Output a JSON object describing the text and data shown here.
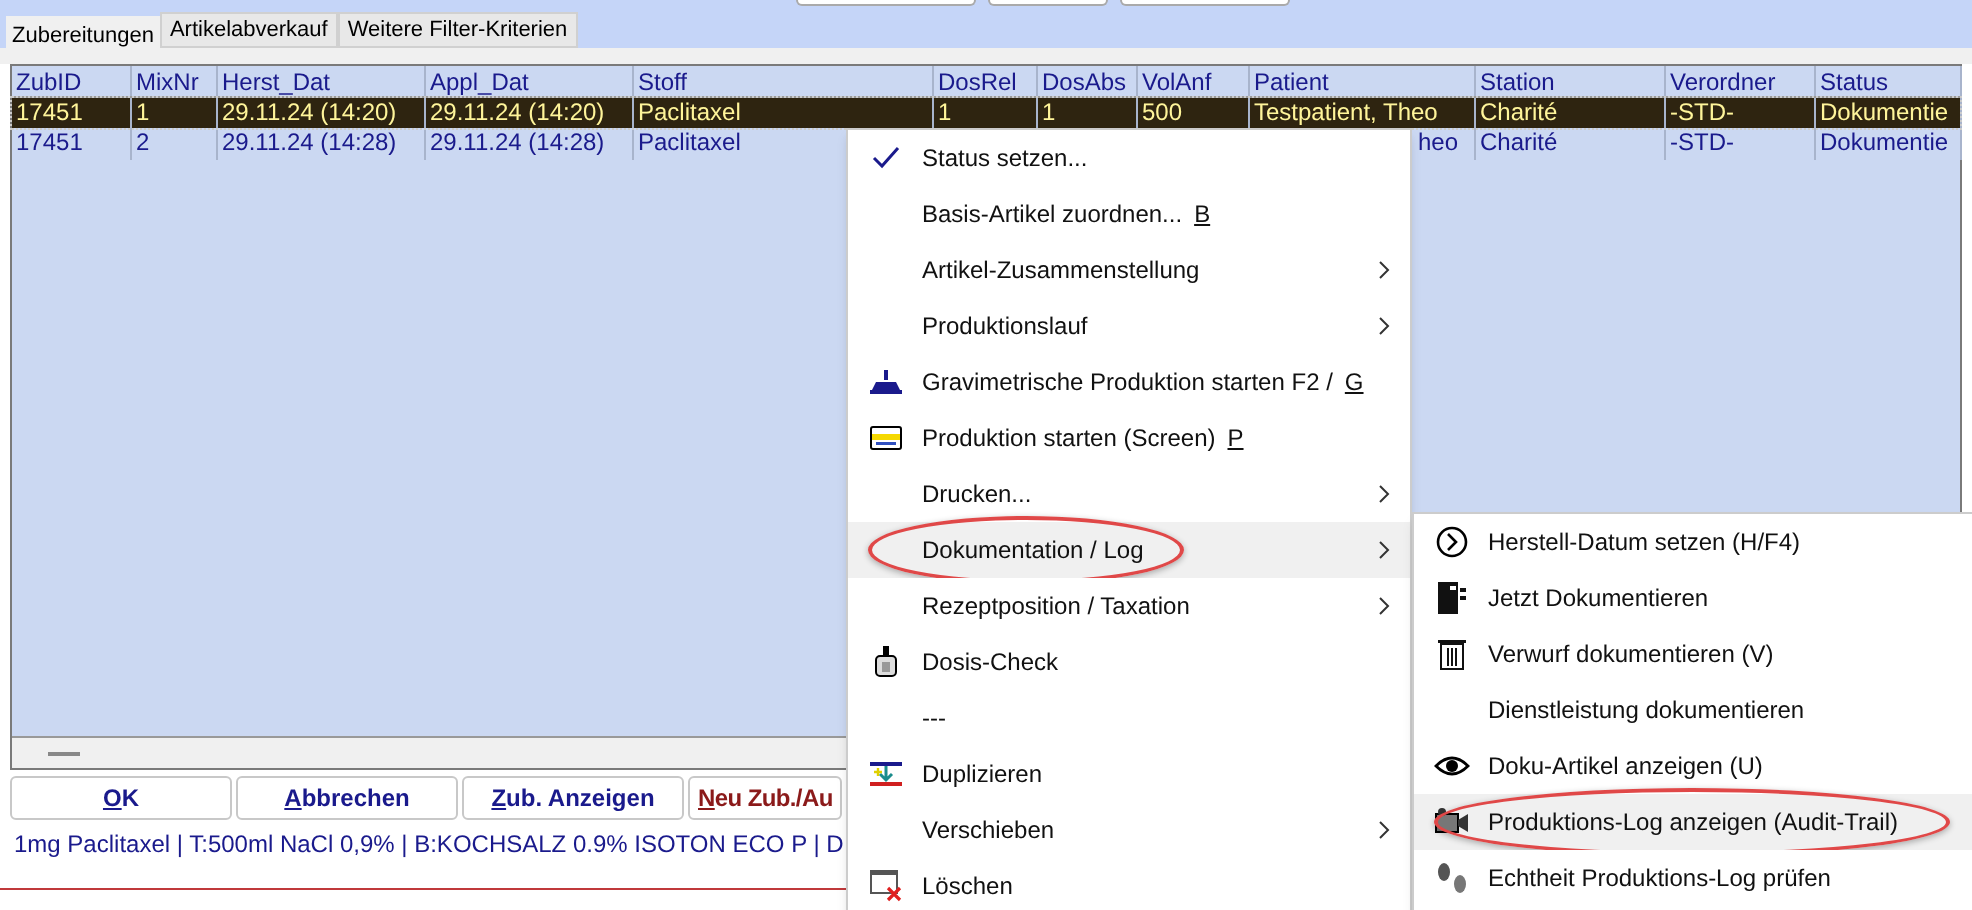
{
  "tabs": [
    {
      "label": "Zubereitungen",
      "selected": true
    },
    {
      "label": "Artikelabverkauf",
      "selected": false
    },
    {
      "label": "Weitere Filter-Kriterien",
      "selected": false
    }
  ],
  "table": {
    "columns": [
      "ZubID",
      "MixNr",
      "Herst_Dat",
      "Appl_Dat",
      "Stoff",
      "DosRel",
      "DosAbs",
      "VolAnf",
      "Patient",
      "Station",
      "Verordner",
      "Status"
    ],
    "rows": [
      {
        "selected": true,
        "cells": [
          "17451",
          "1",
          "29.11.24 (14:20)",
          "29.11.24 (14:20)",
          "Paclitaxel",
          "1",
          "1",
          "500",
          "Testpatient, Theo",
          "Charité",
          "-STD-",
          "Dokumentie"
        ]
      },
      {
        "selected": false,
        "cells": [
          "17451",
          "2",
          "29.11.24 (14:28)",
          "29.11.24 (14:28)",
          "Paclitaxel",
          "",
          "",
          "",
          "heo",
          "Charité",
          "-STD-",
          "Dokumentie"
        ]
      }
    ]
  },
  "buttons": [
    {
      "key": "O",
      "label": "K",
      "kind": "normal"
    },
    {
      "key": "A",
      "label": "bbrechen",
      "kind": "normal"
    },
    {
      "key": "Z",
      "label": "ub. Anzeigen",
      "kind": "normal"
    },
    {
      "key": "N",
      "label": "eu Zub./Au",
      "kind": "new"
    }
  ],
  "status_text": "1mg Paclitaxel | T:500ml NaCl 0,9% | B:KOCHSALZ 0.9% ISOTON ECO P | D",
  "context_menu": [
    {
      "label": "Status setzen...",
      "kind": "check",
      "checked": true,
      "submenu": false,
      "selected": false,
      "circled": false
    },
    {
      "label": "Basis-Artikel zuordnen...",
      "shortcut": "B",
      "kind": "plain",
      "checked": false,
      "submenu": false,
      "selected": false,
      "circled": false
    },
    {
      "label": "Artikel-Zusammenstellung",
      "kind": "plain",
      "checked": false,
      "submenu": true,
      "selected": false,
      "circled": false
    },
    {
      "label": "Produktionslauf",
      "kind": "plain",
      "checked": false,
      "submenu": true,
      "selected": false,
      "circled": false
    },
    {
      "label": "Gravimetrische Produktion starten F2 /",
      "shortcut": "G",
      "kind": "scale",
      "checked": false,
      "submenu": false,
      "selected": false,
      "circled": false
    },
    {
      "label": "Produktion starten (Screen)",
      "shortcut": "P",
      "kind": "screen",
      "checked": false,
      "submenu": false,
      "selected": false,
      "circled": false
    },
    {
      "label": "Drucken...",
      "kind": "plain",
      "checked": false,
      "submenu": true,
      "selected": false,
      "circled": false
    },
    {
      "label": "Dokumentation / Log",
      "kind": "plain",
      "checked": false,
      "submenu": true,
      "selected": true,
      "circled": true
    },
    {
      "label": "Rezeptposition / Taxation",
      "kind": "plain",
      "checked": false,
      "submenu": true,
      "selected": false,
      "circled": false
    },
    {
      "label": "Dosis-Check",
      "kind": "bottle",
      "checked": false,
      "submenu": false,
      "selected": false,
      "circled": false
    },
    {
      "label": "---",
      "kind": "plain",
      "checked": false,
      "submenu": false,
      "selected": false,
      "circled": false
    },
    {
      "label": "Duplizieren",
      "kind": "duplicate",
      "checked": false,
      "submenu": false,
      "selected": false,
      "circled": false
    },
    {
      "label": "Verschieben",
      "kind": "plain",
      "checked": false,
      "submenu": true,
      "selected": false,
      "circled": false
    },
    {
      "label": "Löschen",
      "kind": "delete",
      "checked": false,
      "submenu": false,
      "selected": false,
      "circled": false
    }
  ],
  "submenu": [
    {
      "label": "Herstell-Datum setzen (H/F4)",
      "kind": "clock",
      "selected": false,
      "circled": false
    },
    {
      "label": "Jetzt Dokumentieren",
      "kind": "book",
      "selected": false,
      "circled": false
    },
    {
      "label": "Verwurf dokumentieren (V)",
      "kind": "trash",
      "selected": false,
      "circled": false
    },
    {
      "label": "Dienstleistung dokumentieren",
      "kind": "plain",
      "selected": false,
      "circled": false
    },
    {
      "label": "Doku-Artikel anzeigen (U)",
      "kind": "eye",
      "selected": false,
      "circled": false
    },
    {
      "label": "Produktions-Log anzeigen (Audit-Trail)",
      "kind": "camera",
      "selected": true,
      "circled": true
    },
    {
      "label": "Echtheit Produktions-Log prüfen",
      "kind": "steps",
      "selected": false,
      "circled": false
    }
  ]
}
